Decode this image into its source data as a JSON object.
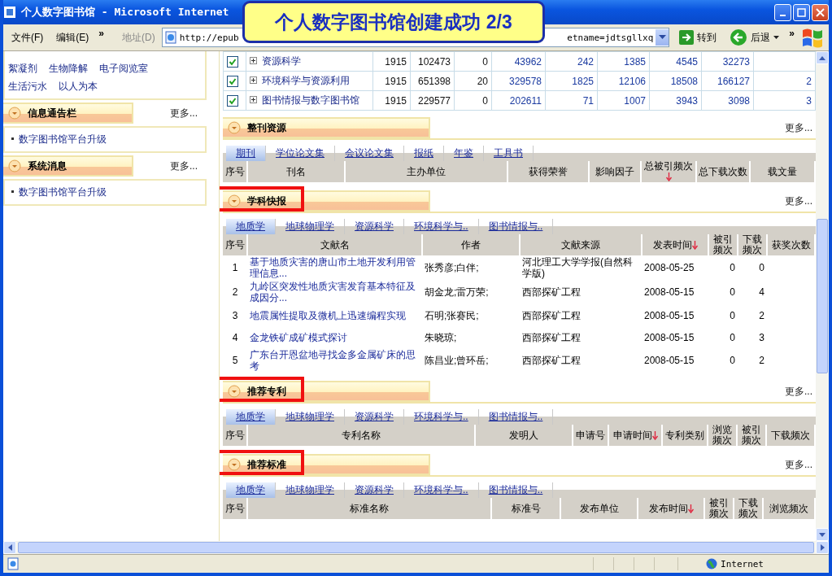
{
  "window": {
    "title": "个人数字图书馆 - Microsoft Internet"
  },
  "callout": {
    "text": "个人数字图书馆创建成功 2/3"
  },
  "toolbar": {
    "menus": [
      "文件(F)",
      "编辑(E)"
    ],
    "menu_chevron": "»",
    "address_label": "地址(D)",
    "address_start": "http://epub",
    "address_end": "etname=jdtsgllxq",
    "go": "转到",
    "back": "后退",
    "back_chevron": "»"
  },
  "sidebar": {
    "tags": [
      "絮凝剂",
      "生物降解",
      "电子阅览室",
      "生活污水",
      "以人为本"
    ],
    "panels": [
      {
        "title": "信息通告栏",
        "more": "更多...",
        "items": [
          "数字图书馆平台升级"
        ]
      },
      {
        "title": "系统消息",
        "more": "更多...",
        "items": [
          "数字图书馆平台升级"
        ]
      }
    ]
  },
  "subject_table": {
    "rows": [
      {
        "checked": true,
        "name": "资源科学",
        "cells": [
          "1915",
          "102473",
          "0",
          "43962",
          "242",
          "1385",
          "4545",
          "32273"
        ]
      },
      {
        "checked": true,
        "name": "环境科学与资源利用",
        "cells": [
          "1915",
          "651398",
          "20",
          "329578",
          "1825",
          "12106",
          "18508",
          "166127",
          "2"
        ]
      },
      {
        "checked": true,
        "name": "图书情报与数字图书馆",
        "cells": [
          "1915",
          "229577",
          "0",
          "202611",
          "71",
          "1007",
          "3943",
          "3098",
          "3"
        ]
      }
    ]
  },
  "sections": [
    {
      "title": "整刊资源",
      "more": "更多...",
      "highlighted": false,
      "tabs": [
        {
          "label": "期刊",
          "selected": true
        },
        {
          "label": "学位论文集",
          "selected": false
        },
        {
          "label": "会议论文集",
          "selected": false
        },
        {
          "label": "报纸",
          "selected": false
        },
        {
          "label": "年鉴",
          "selected": false
        },
        {
          "label": "工具书",
          "selected": false
        }
      ],
      "columns": [
        {
          "label": "序号",
          "sorted": false
        },
        {
          "label": "刊名",
          "sorted": false
        },
        {
          "label": "主办单位",
          "sorted": false
        },
        {
          "label": "获得荣誉",
          "sorted": false
        },
        {
          "label": "影响因子",
          "sorted": false
        },
        {
          "label": "总被引频次",
          "sorted": true
        },
        {
          "label": "总下载次数",
          "sorted": false
        },
        {
          "label": "载文量",
          "sorted": false
        }
      ]
    },
    {
      "title": "学科快报",
      "more": "更多...",
      "highlighted": true,
      "tabs": [
        {
          "label": "地质学",
          "selected": true
        },
        {
          "label": "地球物理学",
          "selected": false
        },
        {
          "label": "资源科学",
          "selected": false
        },
        {
          "label": "环境科学与..",
          "selected": false
        },
        {
          "label": "图书情报与..",
          "selected": false
        }
      ],
      "columns": [
        {
          "label": "序号",
          "sorted": false
        },
        {
          "label": "文献名",
          "sorted": false
        },
        {
          "label": "作者",
          "sorted": false
        },
        {
          "label": "文献来源",
          "sorted": false
        },
        {
          "label": "发表时间",
          "sorted": true
        },
        {
          "label": "被引频次",
          "sorted": false
        },
        {
          "label": "下载频次",
          "sorted": false
        },
        {
          "label": "获奖次数",
          "sorted": false
        }
      ],
      "rows": [
        [
          "1",
          "基于地质灾害的唐山市土地开发利用管理信息...",
          "张秀彦;白伴;",
          "河北理工大学学报(自然科学版)",
          "2008-05-25",
          "0",
          "0"
        ],
        [
          "2",
          "九岭区突发性地质灾害发育基本特征及成因分...",
          "胡金龙;雷万荣;",
          "西部探矿工程",
          "2008-05-15",
          "0",
          "4"
        ],
        [
          "3",
          "地震属性提取及微机上迅速编程实现",
          "石明;张赛民;",
          "西部探矿工程",
          "2008-05-15",
          "0",
          "2"
        ],
        [
          "4",
          "金龙铁矿成矿模式探讨",
          "朱晓琼;",
          "西部探矿工程",
          "2008-05-15",
          "0",
          "3"
        ],
        [
          "5",
          "广东台开恩盆地寻找金多金属矿床的思考",
          "陈昌业;曾环岳;",
          "西部探矿工程",
          "2008-05-15",
          "0",
          "2"
        ]
      ]
    },
    {
      "title": "推荐专利",
      "more": "更多...",
      "highlighted": true,
      "tabs": [
        {
          "label": "地质学",
          "selected": true
        },
        {
          "label": "地球物理学",
          "selected": false
        },
        {
          "label": "资源科学",
          "selected": false
        },
        {
          "label": "环境科学与..",
          "selected": false
        },
        {
          "label": "图书情报与..",
          "selected": false
        }
      ],
      "columns": [
        {
          "label": "序号",
          "sorted": false
        },
        {
          "label": "专利名称",
          "sorted": false
        },
        {
          "label": "发明人",
          "sorted": false
        },
        {
          "label": "申请号",
          "sorted": false
        },
        {
          "label": "申请时间",
          "sorted": true
        },
        {
          "label": "专利类别",
          "sorted": false
        },
        {
          "label": "浏览频次",
          "sorted": false
        },
        {
          "label": "被引频次",
          "sorted": false
        },
        {
          "label": "下载频次",
          "sorted": false
        }
      ]
    },
    {
      "title": "推荐标准",
      "more": "更多...",
      "highlighted": true,
      "tabs": [
        {
          "label": "地质学",
          "selected": true
        },
        {
          "label": "地球物理学",
          "selected": false
        },
        {
          "label": "资源科学",
          "selected": false
        },
        {
          "label": "环境科学与..",
          "selected": false
        },
        {
          "label": "图书情报与..",
          "selected": false
        }
      ],
      "columns": [
        {
          "label": "序号",
          "sorted": false
        },
        {
          "label": "标准名称",
          "sorted": false
        },
        {
          "label": "标准号",
          "sorted": false
        },
        {
          "label": "发布单位",
          "sorted": false
        },
        {
          "label": "发布时间",
          "sorted": true
        },
        {
          "label": "被引频次",
          "sorted": false
        },
        {
          "label": "下载频次",
          "sorted": false
        },
        {
          "label": "浏览频次",
          "sorted": false
        }
      ]
    }
  ],
  "status_bar": {
    "zone": "Internet"
  }
}
